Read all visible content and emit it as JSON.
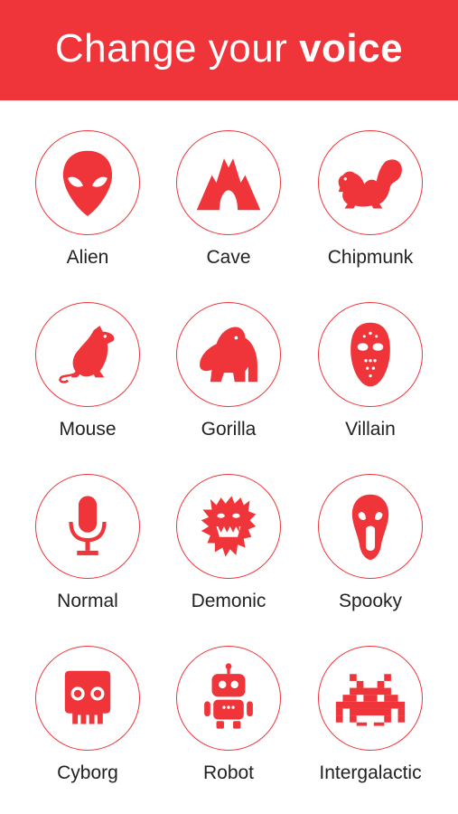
{
  "header": {
    "title_prefix": "Change your",
    "title_bold": "voice",
    "background_color": "#f0353a"
  },
  "voices": [
    {
      "label": "Alien",
      "icon": "alien-icon"
    },
    {
      "label": "Cave",
      "icon": "cave-icon"
    },
    {
      "label": "Chipmunk",
      "icon": "chipmunk-icon"
    },
    {
      "label": "Mouse",
      "icon": "mouse-icon"
    },
    {
      "label": "Gorilla",
      "icon": "gorilla-icon"
    },
    {
      "label": "Villain",
      "icon": "hockey-mask-icon"
    },
    {
      "label": "Normal",
      "icon": "microphone-icon"
    },
    {
      "label": "Demonic",
      "icon": "demon-icon"
    },
    {
      "label": "Spooky",
      "icon": "ghost-scream-icon"
    },
    {
      "label": "Cyborg",
      "icon": "skull-icon"
    },
    {
      "label": "Robot",
      "icon": "robot-icon"
    },
    {
      "label": "Intergalactic",
      "icon": "space-invader-icon"
    }
  ],
  "accent_color": "#f0353a"
}
